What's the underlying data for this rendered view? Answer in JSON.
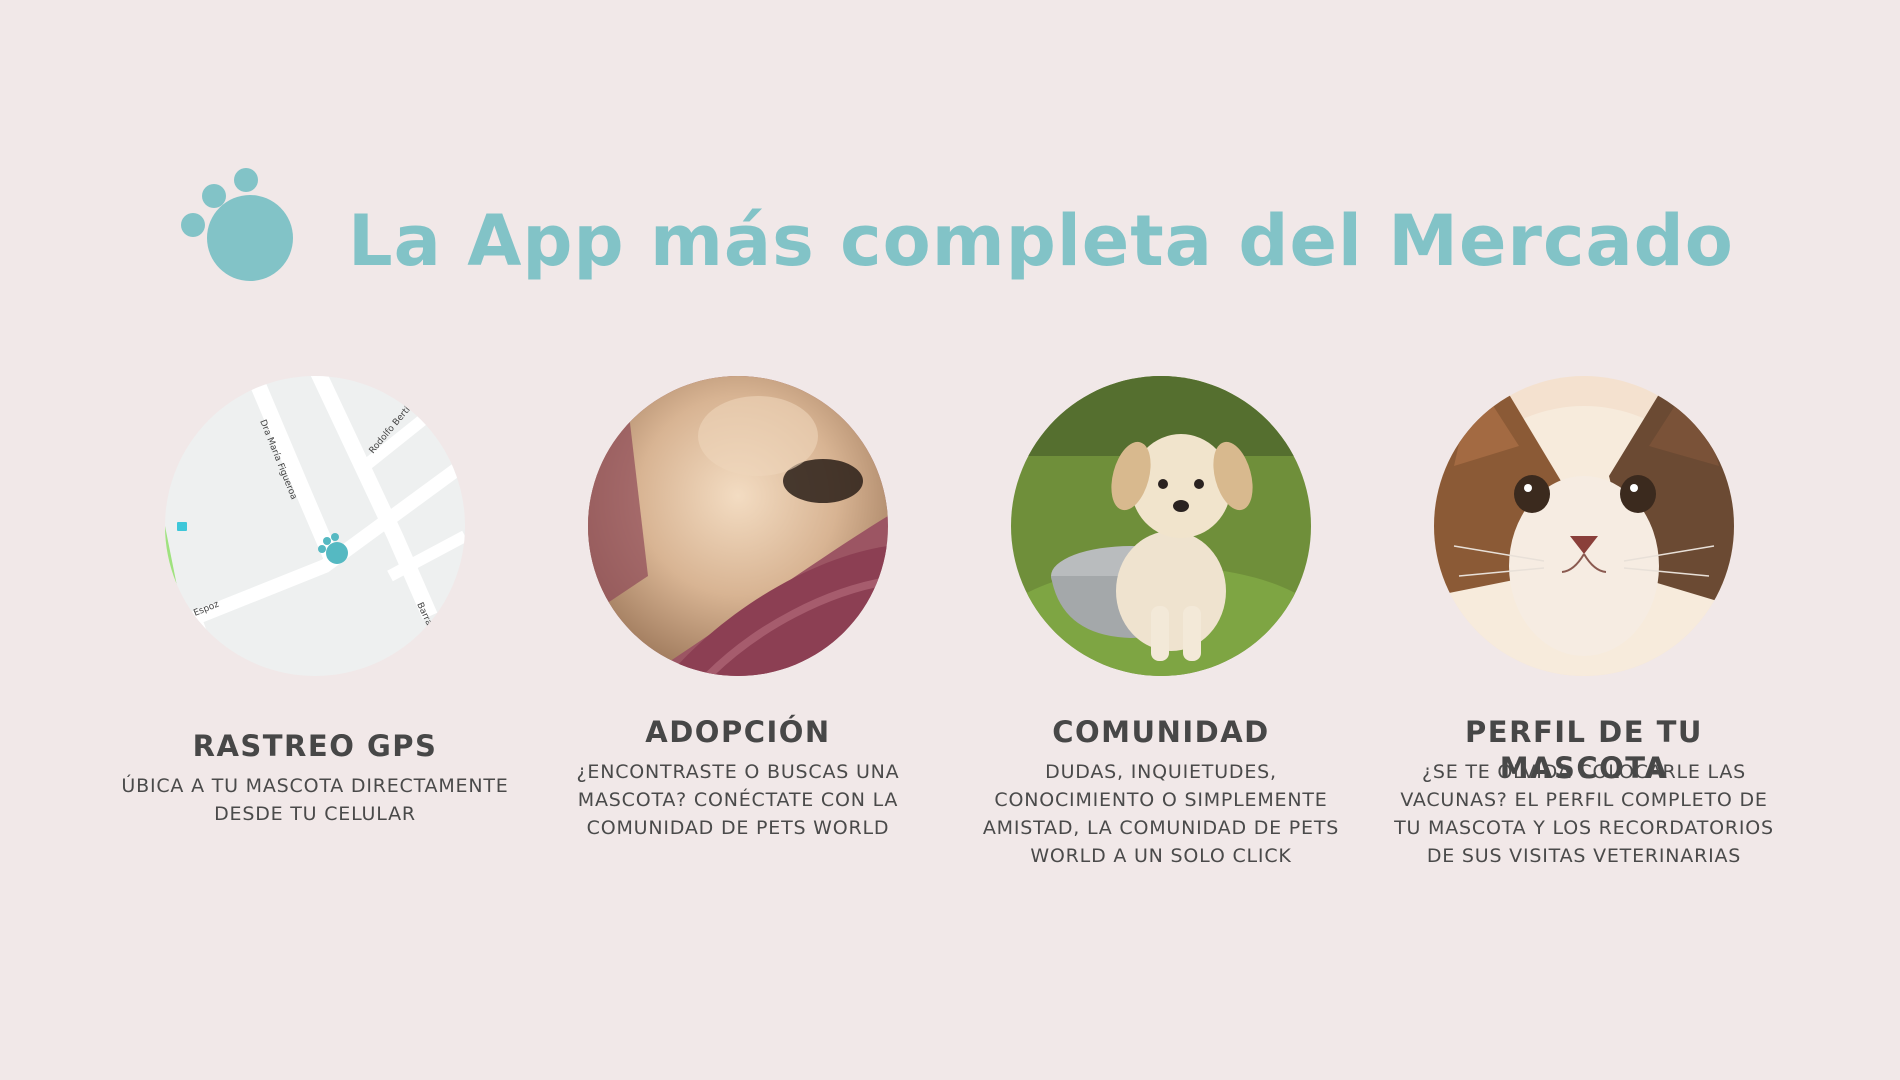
{
  "header": {
    "title": "La App más completa del Mercado",
    "logo_icon": "paw-icon",
    "accent_color": "#82c3c7"
  },
  "features": [
    {
      "title": "RASTREO GPS",
      "description": "ÚBICA A TU MASCOTA DIRECTAMENTE DESDE TU CELULAR",
      "image": "map-with-paw-marker",
      "map_labels": {
        "street1": "Dra María Figueroa",
        "street2": "Rodolfo Bertí",
        "street3": "Espoz",
        "street4": "Barrab"
      }
    },
    {
      "title": "ADOPCIÓN",
      "description": "¿ENCONTRASTE O BUSCAS UNA MASCOTA? CONÉCTATE CON LA COMUNIDAD DE PETS WORLD",
      "image": "sleeping-dog-photo"
    },
    {
      "title": "COMUNIDAD",
      "description": "DUDAS, INQUIETUDES, CONOCIMIENTO O SIMPLEMENTE AMISTAD, LA COMUNIDAD DE PETS WORLD A UN SOLO CLICK",
      "image": "puppy-in-bowl-photo"
    },
    {
      "title": "PERFIL DE TU MASCOTA",
      "description": "¿SE TE OLVIDA COLOCARLE LAS VACUNAS? EL PERFIL COMPLETO DE TU MASCOTA Y LOS RECORDATORIOS DE SUS VISITAS VETERINARIAS",
      "image": "cat-face-photo"
    }
  ]
}
